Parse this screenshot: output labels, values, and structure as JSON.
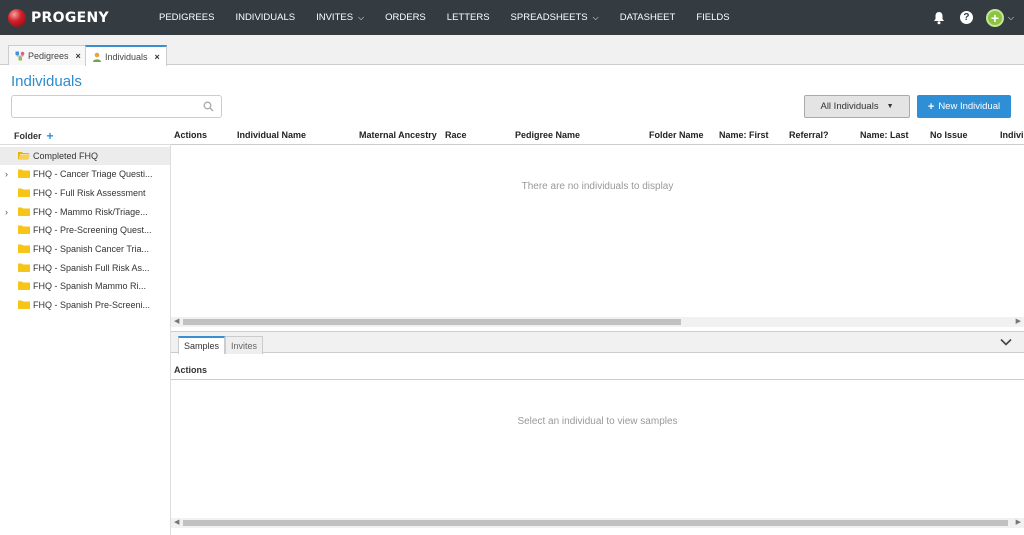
{
  "app": {
    "name": "PROGENY"
  },
  "nav": {
    "items": [
      {
        "label": "PEDIGREES",
        "dropdown": false
      },
      {
        "label": "INDIVIDUALS",
        "dropdown": false
      },
      {
        "label": "INVITES",
        "dropdown": true
      },
      {
        "label": "ORDERS",
        "dropdown": false
      },
      {
        "label": "LETTERS",
        "dropdown": false
      },
      {
        "label": "SPREADSHEETS",
        "dropdown": true
      },
      {
        "label": "DATASHEET",
        "dropdown": false
      },
      {
        "label": "FIELDS",
        "dropdown": false
      }
    ],
    "help_label": "?",
    "add_label": "+"
  },
  "tabs": [
    {
      "label": "Pedigrees",
      "close": "×",
      "active": false
    },
    {
      "label": "Individuals",
      "close": "×",
      "active": true
    }
  ],
  "page": {
    "title": "Individuals",
    "search_placeholder": "",
    "filter_label": "All Individuals",
    "new_button_label": "New Individual",
    "new_button_plus": "+"
  },
  "folders": {
    "header": "Folder",
    "add_label": "+",
    "items": [
      {
        "label": "Completed FHQ",
        "expandable": false,
        "selected": true
      },
      {
        "label": "FHQ - Cancer Triage Questi...",
        "expandable": true,
        "selected": false
      },
      {
        "label": "FHQ - Full Risk Assessment",
        "expandable": false,
        "selected": false
      },
      {
        "label": "FHQ - Mammo Risk/Triage...",
        "expandable": true,
        "selected": false
      },
      {
        "label": "FHQ - Pre-Screening Quest...",
        "expandable": false,
        "selected": false
      },
      {
        "label": "FHQ - Spanish Cancer Tria...",
        "expandable": false,
        "selected": false
      },
      {
        "label": "FHQ - Spanish Full Risk As...",
        "expandable": false,
        "selected": false
      },
      {
        "label": "FHQ - Spanish Mammo Ri...",
        "expandable": false,
        "selected": false
      },
      {
        "label": "FHQ - Spanish Pre-Screeni...",
        "expandable": false,
        "selected": false
      }
    ]
  },
  "table": {
    "columns": [
      "Actions",
      "Individual Name",
      "Maternal Ancestry",
      "Race",
      "Pedigree Name",
      "Folder Name",
      "Name: First",
      "Referral?",
      "Name: Last",
      "No Issue",
      "Indivi"
    ],
    "empty_message": "There are no individuals to display"
  },
  "bottom": {
    "tabs": [
      {
        "label": "Samples",
        "active": true
      },
      {
        "label": "Invites",
        "active": false
      }
    ],
    "actions_header": "Actions",
    "empty_message": "Select an individual to view samples"
  },
  "colors": {
    "nav_bg": "#343c42",
    "accent": "#2e8fd6",
    "folder": "#f5c518",
    "add_green": "#8bc53f"
  }
}
